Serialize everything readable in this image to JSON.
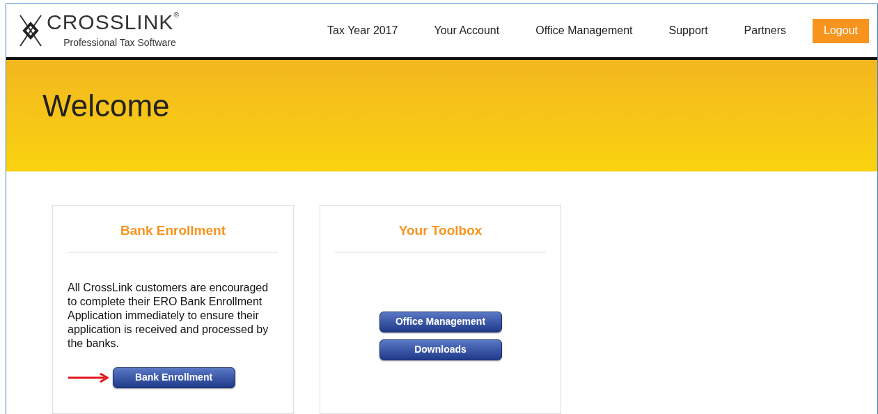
{
  "logo": {
    "name": "CROSSLINK",
    "mark": "®",
    "tagline": "Professional Tax Software"
  },
  "nav": [
    {
      "label": "Tax Year 2017",
      "kind": "link"
    },
    {
      "label": "Your Account",
      "kind": "link"
    },
    {
      "label": "Office Management",
      "kind": "link"
    },
    {
      "label": "Support",
      "kind": "link"
    },
    {
      "label": "Partners",
      "kind": "link"
    },
    {
      "label": "Logout",
      "kind": "button"
    }
  ],
  "banner": {
    "title": "Welcome"
  },
  "cards": [
    {
      "title": "Bank Enrollment",
      "text": "All CrossLink customers are encouraged to complete their ERO Bank Enrollment Application immediately to ensure their application is received and processed by the banks.",
      "buttons": [
        {
          "label": "Bank Enrollment",
          "arrow": true
        }
      ]
    },
    {
      "title": "Your Toolbox",
      "buttons": [
        {
          "label": "Office Management",
          "arrow": false
        },
        {
          "label": "Downloads",
          "arrow": false
        }
      ]
    }
  ]
}
